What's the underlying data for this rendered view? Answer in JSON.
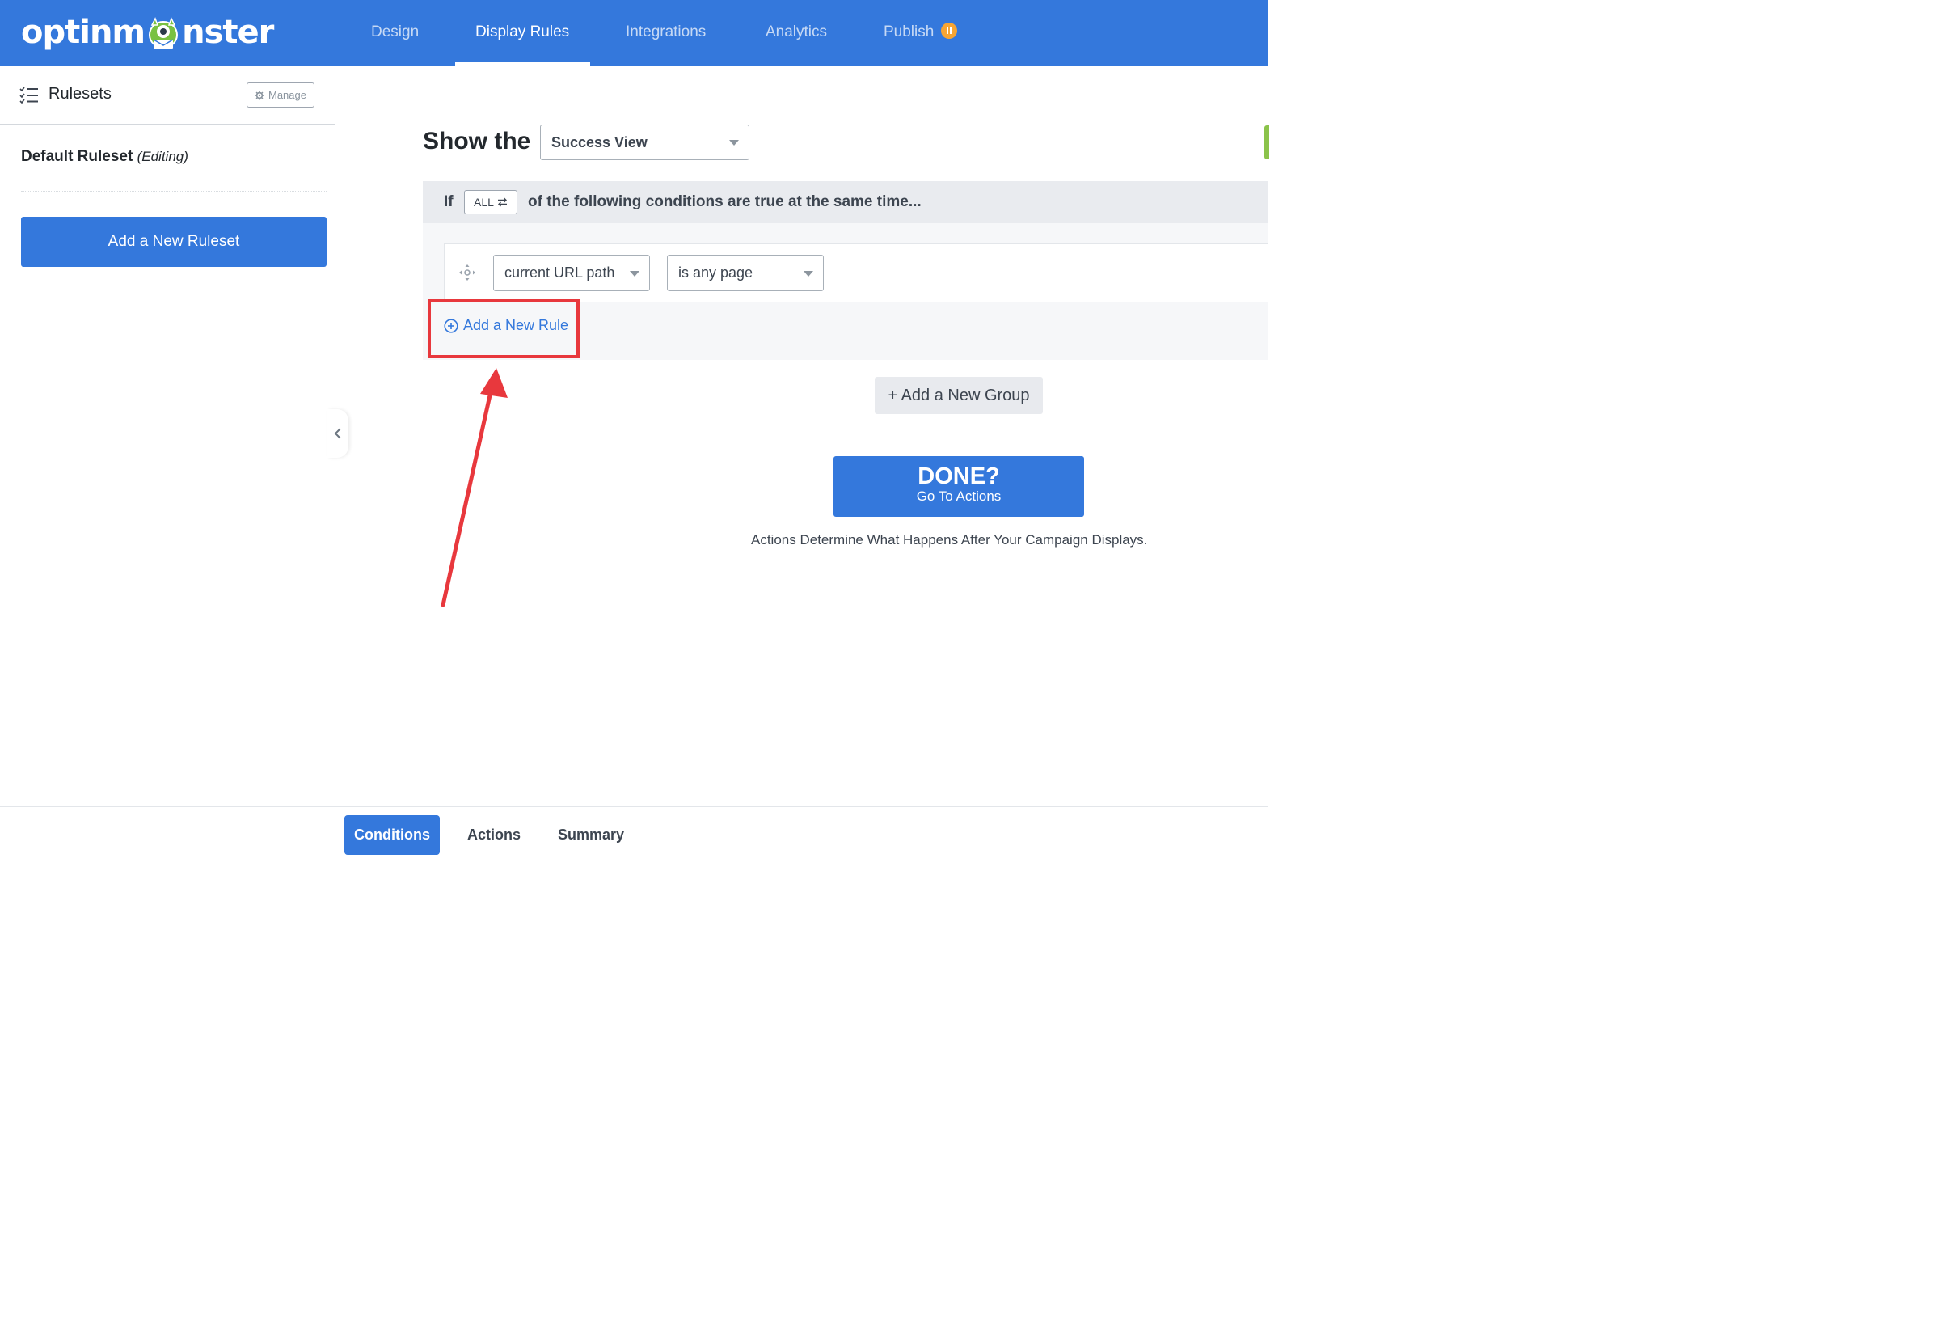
{
  "header": {
    "logo_text_before": "optinm",
    "logo_text_after": "nster",
    "nav": [
      {
        "label": "Design",
        "active": false
      },
      {
        "label": "Display Rules",
        "active": true
      },
      {
        "label": "Integrations",
        "active": false
      },
      {
        "label": "Analytics",
        "active": false
      },
      {
        "label": "Publish",
        "active": false,
        "badge": "pause-icon"
      }
    ]
  },
  "sidebar": {
    "title": "Rulesets",
    "manage_label": "Manage",
    "ruleset_name": "Default Ruleset",
    "ruleset_status": "(Editing)",
    "add_ruleset_label": "Add a New Ruleset"
  },
  "main": {
    "show_the": "Show the",
    "view_select": "Success View",
    "if_label": "If",
    "match_toggle": "ALL",
    "conditions_text": "of the following conditions are true at the same time...",
    "rule": {
      "field": "current URL path",
      "operator": "is any page"
    },
    "add_rule_label": "Add a New Rule",
    "add_group_label": "+ Add a New Group",
    "done_title": "DONE?",
    "done_subtitle": "Go To Actions",
    "actions_note": "Actions Determine What Happens After Your Campaign Displays."
  },
  "bottom_tabs": [
    {
      "label": "Conditions",
      "active": true
    },
    {
      "label": "Actions",
      "active": false
    },
    {
      "label": "Summary",
      "active": false
    }
  ],
  "colors": {
    "brand_blue": "#3478dc",
    "badge_orange": "#f7a533",
    "annotation_red": "#e8383d"
  }
}
